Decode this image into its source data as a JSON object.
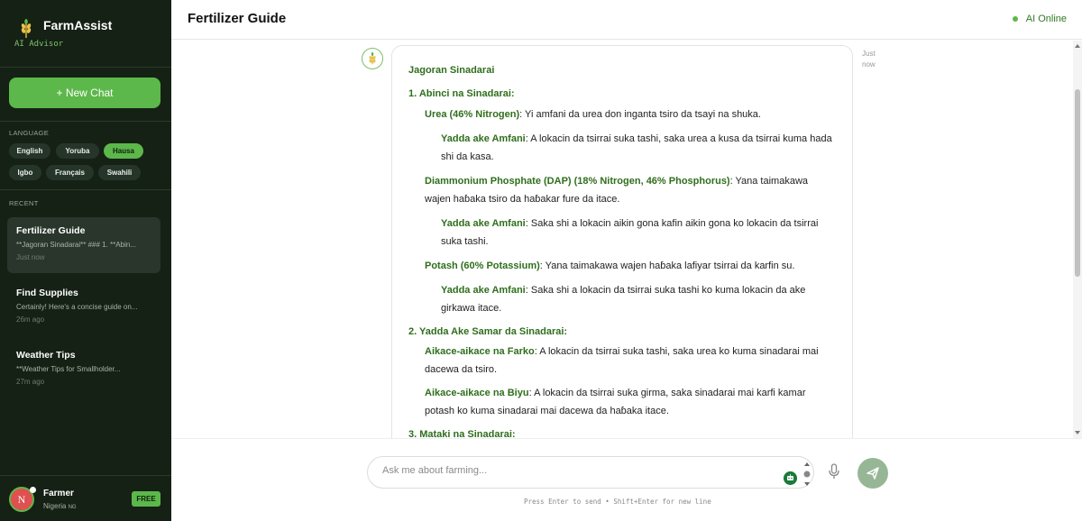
{
  "sidebar": {
    "brand_name": "FarmAssist",
    "brand_sub": "AI Advisor",
    "new_chat_label": "+ New Chat",
    "language_label": "LANGUAGE",
    "languages": [
      "English",
      "Yoruba",
      "Hausa",
      "Igbo",
      "Français",
      "Swahili"
    ],
    "active_language": "Hausa",
    "recent_label": "RECENT",
    "recent": [
      {
        "title": "Fertilizer Guide",
        "preview": "**Jagoran Sinadarai** ### 1. **Abin...",
        "time": "Just now",
        "active": true
      },
      {
        "title": "Find Supplies",
        "preview": "Certainly! Here's a concise guide on...",
        "time": "26m ago",
        "active": false
      },
      {
        "title": "Weather Tips",
        "preview": "**Weather Tips for Smallholder...",
        "time": "27m ago",
        "active": false
      }
    ],
    "user": {
      "initial": "N",
      "name": "Farmer",
      "location": "Nigeria",
      "country_code": "NG",
      "plan": "FREE"
    }
  },
  "header": {
    "title": "Fertilizer Guide",
    "status": "AI Online"
  },
  "message": {
    "time_line1": "Just",
    "time_line2": "now",
    "title": "Jagoran Sinadarai",
    "s1_heading": "1. Abinci na Sinadarai:",
    "urea_label": "Urea (46% Nitrogen)",
    "urea_text": ": Yi amfani da urea don inganta tsiro da tsayi na shuka.",
    "urea_use_label": "Yadda ake Amfani",
    "urea_use_text_1": ": A lokacin da tsirrai suka tashi, saka urea a kusa da tsirrai kuma hada",
    "urea_use_text_2": "shi da kasa.",
    "dap_label": "Diammonium Phosphate (DAP) (18% Nitrogen, 46% Phosphorus)",
    "dap_text_1": ": Yana taimakawa",
    "dap_text_2": "wajen haɓaka tsiro da haɓakar fure da itace.",
    "dap_use_label": "Yadda ake Amfani",
    "dap_use_text_1": ": Saka shi a lokacin aikin gona kafin aikin gona ko lokacin da tsirrai",
    "dap_use_text_2": "suka tashi.",
    "potash_label": "Potash (60% Potassium)",
    "potash_text": ": Yana taimakawa wajen haɓaka lafiyar tsirrai da karfin su.",
    "potash_use_label": "Yadda ake Amfani",
    "potash_use_text_1": ": Saka shi a lokacin da tsirrai suka tashi ko kuma lokacin da ake",
    "potash_use_text_2": "girkawa itace.",
    "s2_heading": "2. Yadda Ake Samar da Sinadarai:",
    "farko_label": "Aikace-aikace na Farko",
    "farko_text_1": ": A lokacin da tsirrai suka tashi, saka urea ko kuma sinadarai mai",
    "farko_text_2": "dacewa da tsiro.",
    "biyu_label": "Aikace-aikace na Biyu",
    "biyu_text_1": ": A lokacin da tsirrai suka girma, saka sinadarai mai karfi kamar",
    "biyu_text_2": "potash ko kuma sinadarai mai dacewa da haɓaka itace.",
    "s3_heading": "3. Mataki na Sinadarai:"
  },
  "composer": {
    "placeholder": "Ask me about farming...",
    "hint": "Press Enter to send • Shift+Enter for new line"
  },
  "colors": {
    "accent": "#5cb84a",
    "sidebar_bg": "#152115",
    "heading_green": "#2f6e1c"
  }
}
